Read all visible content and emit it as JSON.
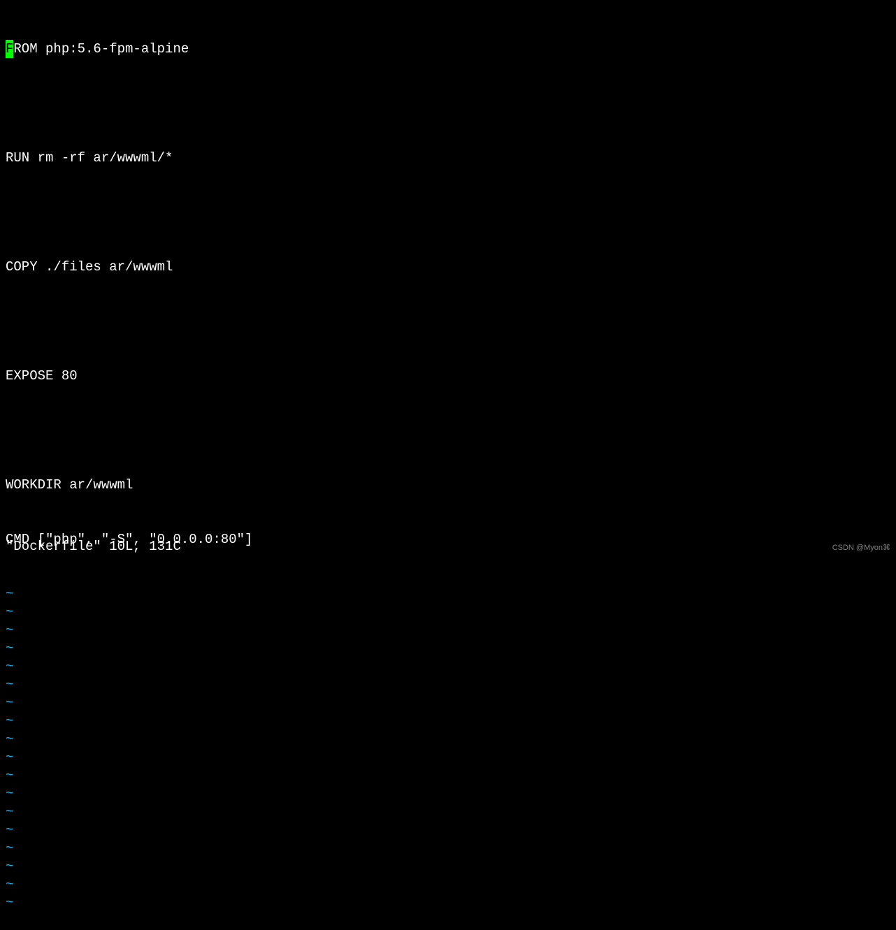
{
  "editor": {
    "cursor_char": "F",
    "lines": [
      "ROM php:5.6-fpm-alpine",
      "",
      "RUN rm -rf ar/wwwml/*",
      "",
      "COPY ./files ar/wwwml",
      "",
      "EXPOSE 80",
      "",
      "WORKDIR ar/wwwml",
      "CMD [\"php\", \"-S\", \"0.0.0.0:80\"]"
    ],
    "tilde_count": 18,
    "tilde_char": "~"
  },
  "status": {
    "text": "\"Dockerfile\" 10L, 131C"
  },
  "watermark": {
    "text": "CSDN @Myon⌘"
  }
}
